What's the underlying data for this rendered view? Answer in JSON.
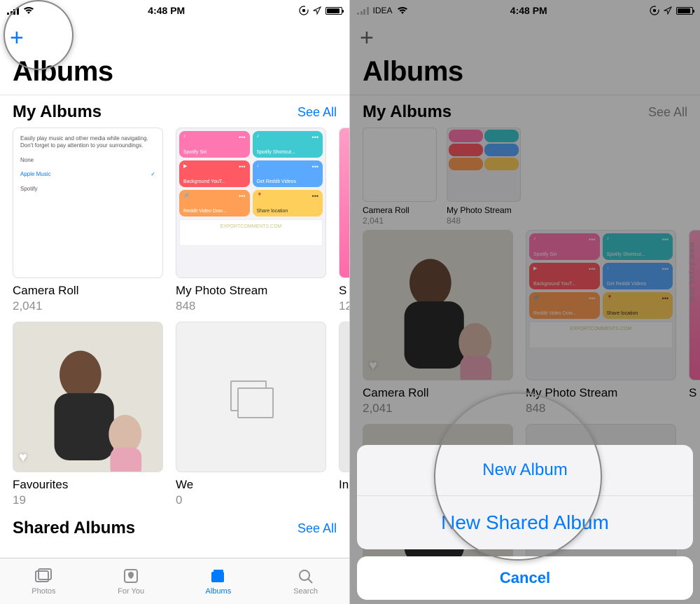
{
  "status": {
    "carrier_left": "IDEA",
    "time": "4:48 PM"
  },
  "screen_title": "Albums",
  "my_albums": {
    "heading": "My Albums",
    "see_all": "See All"
  },
  "camera_card": {
    "desc": "Easily play music and other media while navigating. Don't forget to pay attention to your surroundings.",
    "opt_none": "None",
    "opt_apple": "Apple Music",
    "opt_spotify": "Spotify"
  },
  "tiles": {
    "t1": "Spotify Siri",
    "t2": "Spotify Shortcut...",
    "t3": "Background YouT...",
    "t4": "Get Reddit Videos",
    "t5": "Reddit Video Dow...",
    "t6": "Share location",
    "bottom": "EXPORTCOMMENTS.COM"
  },
  "albums": {
    "camera_roll": {
      "title": "Camera Roll",
      "count": "2,041"
    },
    "photo_stream": {
      "title": "My Photo Stream",
      "count": "848"
    },
    "peek_s": "S",
    "peek_s_count": "12",
    "favourites": {
      "title": "Favourites",
      "count": "19"
    },
    "we": {
      "title": "We",
      "count": "0"
    },
    "peek_i": "In"
  },
  "shared": {
    "heading": "Shared Albums",
    "see_all": "See All"
  },
  "tabs": {
    "photos": "Photos",
    "for_you": "For You",
    "albums": "Albums",
    "search": "Search"
  },
  "sheet": {
    "new_album": "New Album",
    "new_shared": "Shared A",
    "cancel": "Cancel"
  },
  "watermark": "www.deyaq.com"
}
